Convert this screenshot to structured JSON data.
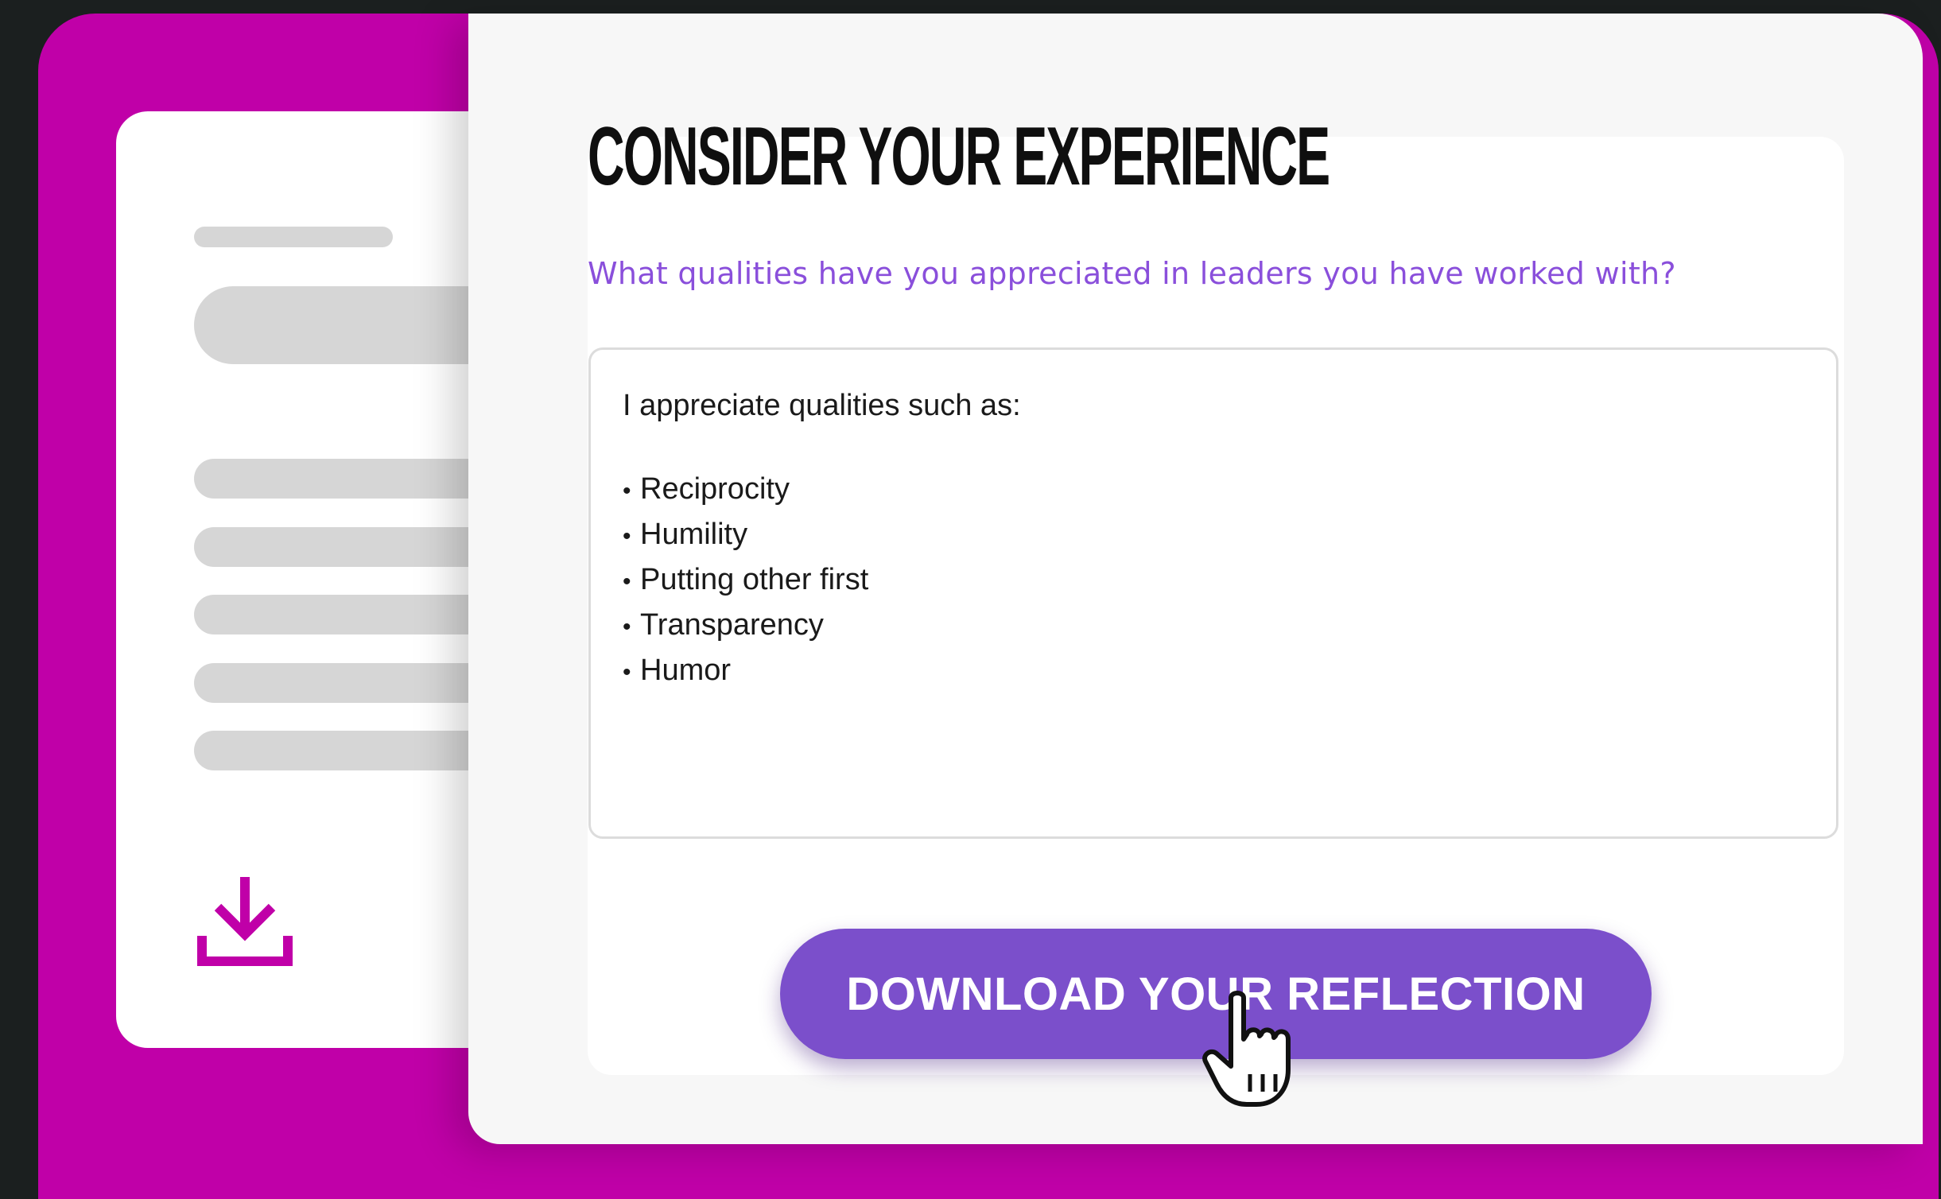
{
  "colors": {
    "background": "#1b1f1f",
    "accent_magenta": "#c000a8",
    "button_purple": "#7b4fcb",
    "question_purple": "#8a4fdb"
  },
  "card": {
    "title": "CONSIDER YOUR EXPERIENCE",
    "question": "What qualities have you appreciated in leaders you have worked with?",
    "answer": {
      "intro": "I appreciate qualities such as:",
      "items": [
        "Reciprocity",
        "Humility",
        "Putting other first",
        "Transparency",
        "Humor"
      ]
    },
    "button_label": "DOWNLOAD YOUR REFLECTION"
  },
  "icons": {
    "download": "download-icon",
    "cursor": "hand-pointer-icon"
  }
}
